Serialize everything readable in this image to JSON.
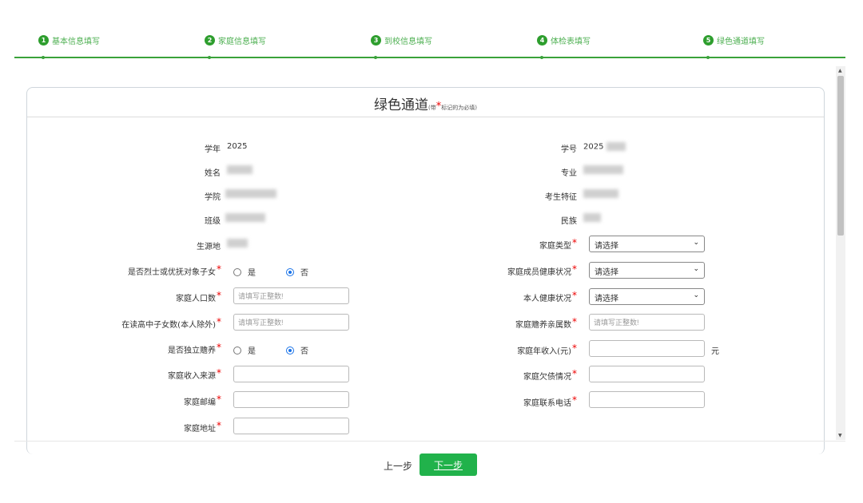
{
  "steps": [
    {
      "num": "1",
      "label": "基本信息填写"
    },
    {
      "num": "2",
      "label": "家庭信息填写"
    },
    {
      "num": "3",
      "label": "到校信息填写"
    },
    {
      "num": "4",
      "label": "体检表填写"
    },
    {
      "num": "5",
      "label": "绿色通道填写"
    }
  ],
  "panel": {
    "title": "绿色通道",
    "note_prefix": "(带",
    "note_star": "*",
    "note_suffix": "标记的为必填)"
  },
  "left": {
    "year_label": "学年",
    "year_value": "2025",
    "name_label": "姓名",
    "college_label": "学院",
    "class_label": "班级",
    "origin_label": "生源地",
    "martyr_label": "是否烈士或优抚对象子女",
    "pop_label": "家庭人口数",
    "pop_placeholder": "请填写正整数!",
    "children_label": "在读高中子女数(本人除外)",
    "children_placeholder": "请填写正整数!",
    "alone_label": "是否独立赡养",
    "income_src_label": "家庭收入来源",
    "zip_label": "家庭邮编",
    "addr_label": "家庭地址",
    "yes": "是",
    "no": "否"
  },
  "right": {
    "id_label": "学号",
    "id_value": "2025",
    "major_label": "专业",
    "feature_label": "考生特征",
    "ethnic_label": "民族",
    "family_type_label": "家庭类型",
    "family_type_value": "请选择",
    "health_family_label": "家庭成员健康状况",
    "health_family_value": "请选择",
    "health_self_label": "本人健康状况",
    "health_self_value": "请选择",
    "support_label": "家庭赡养亲属数",
    "support_placeholder": "请填写正整数!",
    "income_label": "家庭年收入(元)",
    "income_unit": "元",
    "debt_label": "家庭欠债情况",
    "phone_label": "家庭联系电话"
  },
  "footer": {
    "prev": "上一步",
    "next": "下一步"
  }
}
